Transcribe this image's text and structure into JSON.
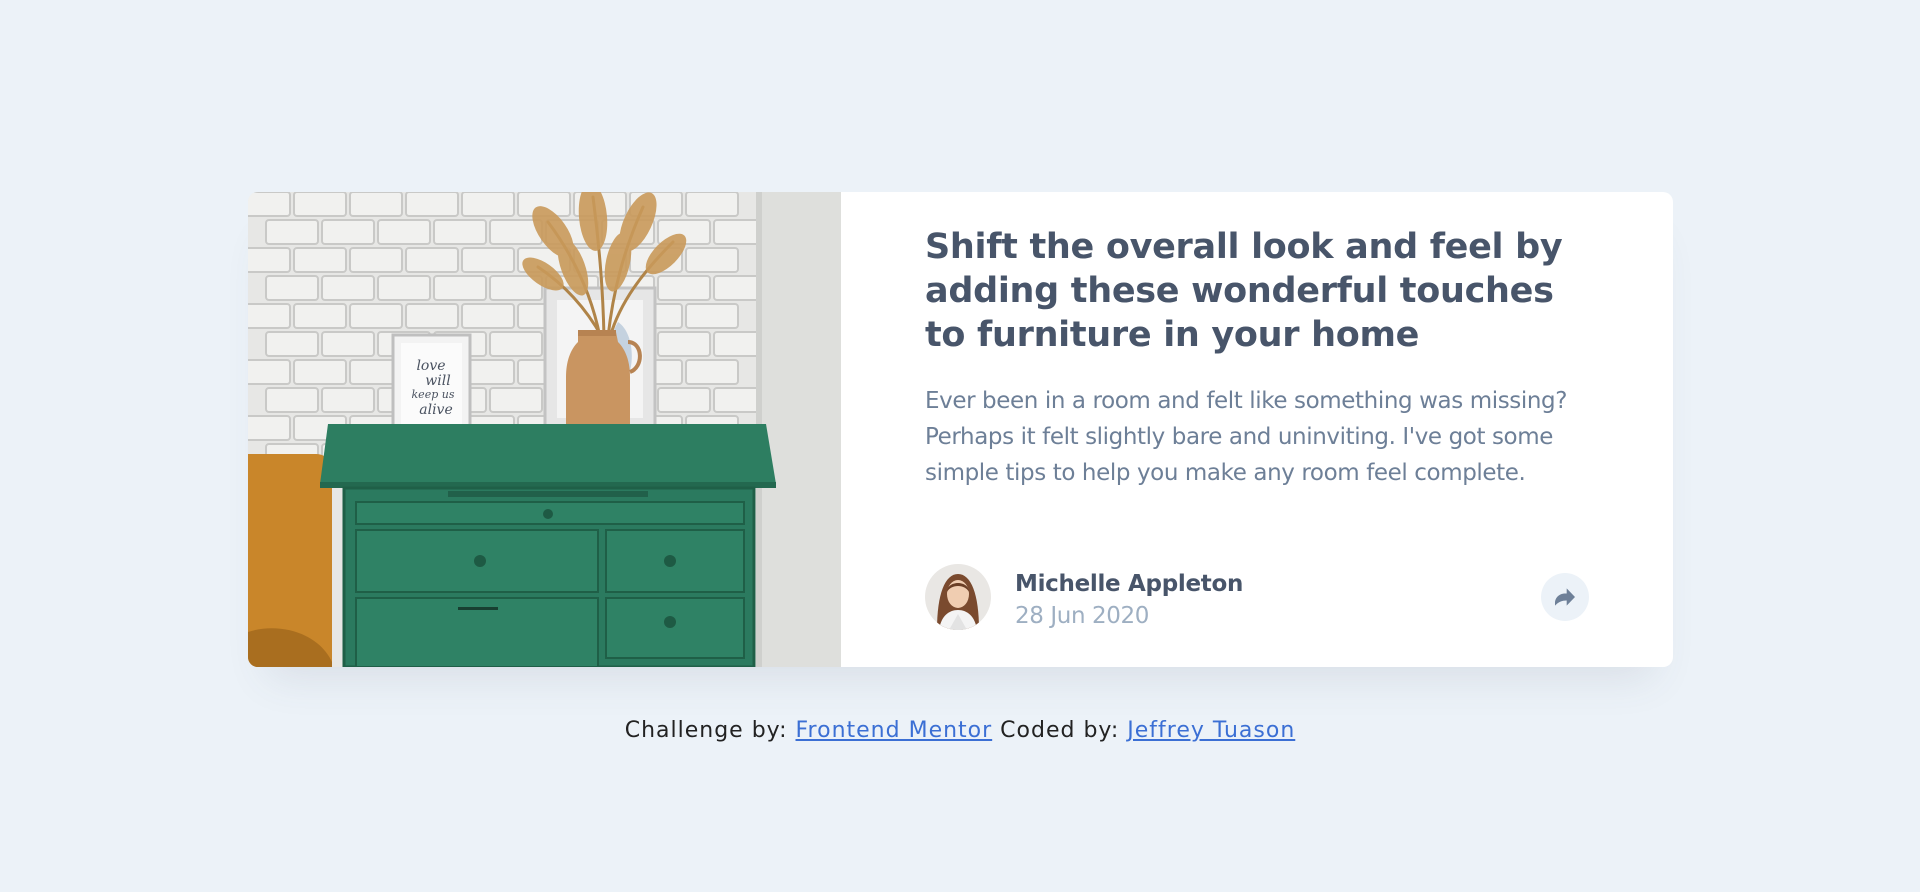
{
  "article": {
    "title": "Shift the overall look and feel by adding these wonderful touches to furniture in your home",
    "description": "Ever been in a room and felt like something was missing? Perhaps it felt slightly bare and uninviting. I've got some simple tips to help you make any room feel complete.",
    "image_alt": "drawers",
    "frame_text": [
      "love",
      "will",
      "keep us",
      "alive"
    ]
  },
  "author": {
    "name": "Michelle Appleton",
    "date": "28 Jun 2020",
    "avatar_icon": "avatar-photo"
  },
  "share": {
    "icon": "share-arrow-icon"
  },
  "attribution": {
    "challenge_label": "Challenge by:",
    "challenge_link": "Frontend Mentor",
    "coded_label": "Coded by:",
    "coded_link": "Jeffrey Tuason"
  },
  "colors": {
    "page_background": "#ecf2f8",
    "card_background": "#ffffff",
    "heading": "#48556a",
    "body_text": "#6d7f97",
    "muted_text": "#9eafc2",
    "link": "#3b6fd4",
    "drawer_green": "#2b7a5f"
  }
}
